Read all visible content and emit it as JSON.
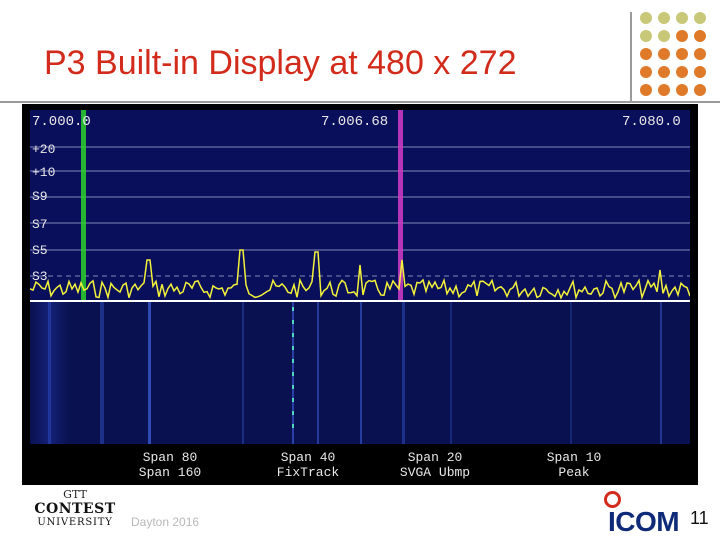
{
  "slide": {
    "title": "P3 Built-in Display at 480 x 272",
    "footer": "Dayton 2016",
    "page_number": "11"
  },
  "display": {
    "freq_left": "7.000.0",
    "freq_center": "7.006.68",
    "freq_right": "7.080.0",
    "scale_labels": [
      "+20",
      "+10",
      "S9",
      "S7",
      "S5",
      "S3"
    ],
    "softkeys": [
      {
        "line1": "Span 80",
        "line2": "Span 160"
      },
      {
        "line1": "Span 40",
        "line2": "FixTrack"
      },
      {
        "line1": "Span 20",
        "line2": "SVGA Ubmp"
      },
      {
        "line1": "Span 10",
        "line2": "Peak"
      }
    ]
  },
  "logos": {
    "contest_top": "GTT",
    "contest_main": "CONTEST",
    "contest_sub": "UNIVERSITY",
    "brand": "ICOM"
  },
  "colors": {
    "title": "#d22b1b",
    "spectrum_bg": "#0a0f5c",
    "trace": "#f2f23a",
    "marker_green": "#2bd22b",
    "marker_magenta": "#d23cc8"
  }
}
